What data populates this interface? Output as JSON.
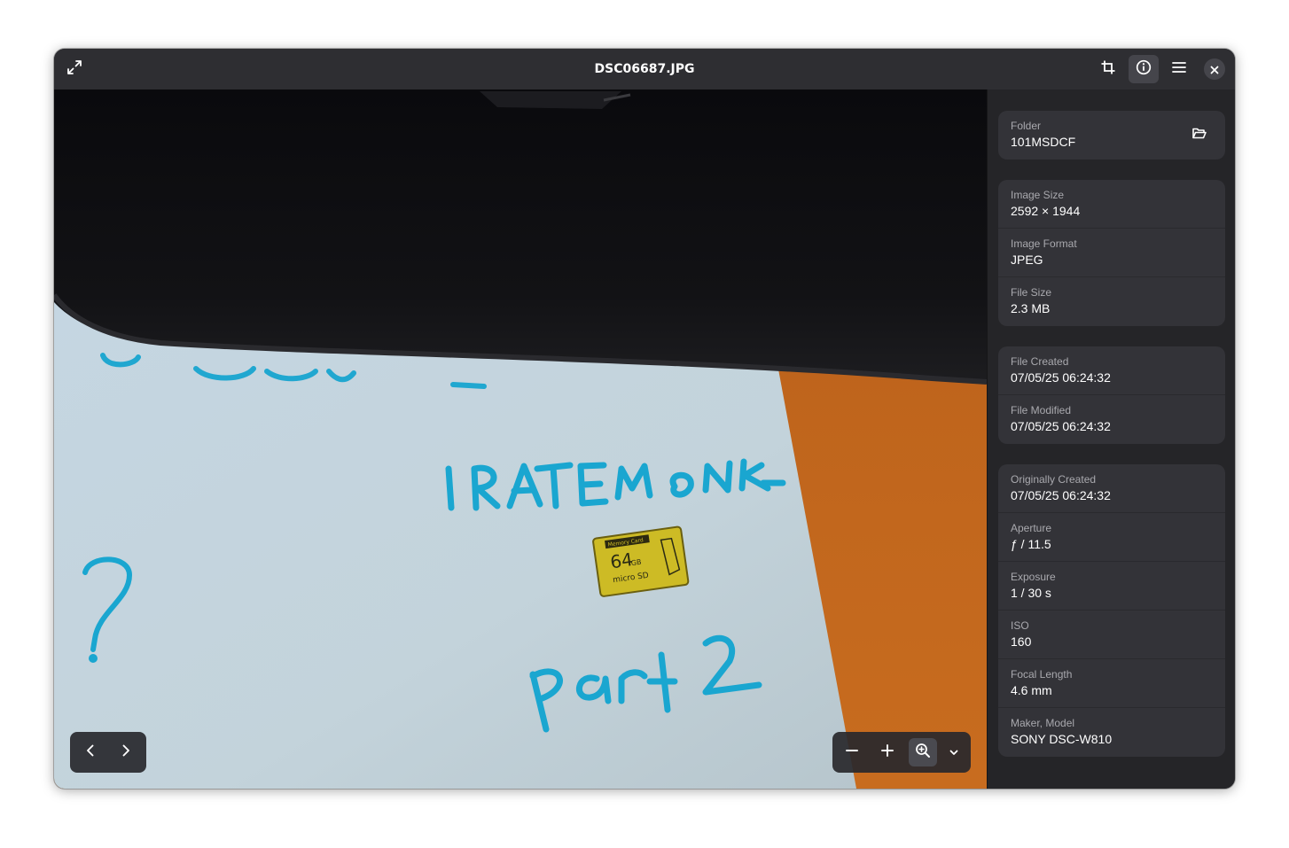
{
  "window": {
    "title": "DSC06687.JPG"
  },
  "headerbar": {
    "fullscreen_icon": "fullscreen-icon",
    "crop_icon": "crop-icon",
    "info_icon": "info-icon",
    "menu_icon": "hamburger-menu-icon",
    "close_icon": "close-icon"
  },
  "photo": {
    "handwritten_text_1": "IRATEMONK",
    "handwritten_text_2": "part 2",
    "handwritten_text_3": "?",
    "card_label": "Memory Card",
    "card_capacity": "64GB",
    "card_type": "micro SD"
  },
  "properties": {
    "folder": {
      "label": "Folder",
      "value": "101MSDCF"
    },
    "image": [
      {
        "label": "Image Size",
        "value": "2592 × 1944"
      },
      {
        "label": "Image Format",
        "value": "JPEG"
      },
      {
        "label": "File Size",
        "value": "2.3 MB"
      }
    ],
    "file_dates": [
      {
        "label": "File Created",
        "value": "07/05/25 06:24:32"
      },
      {
        "label": "File Modified",
        "value": "07/05/25 06:24:32"
      }
    ],
    "exif": [
      {
        "label": "Originally Created",
        "value": "07/05/25 06:24:32"
      },
      {
        "label": "Aperture",
        "value": "ƒ / 11.5"
      },
      {
        "label": "Exposure",
        "value": "1 / 30 s"
      },
      {
        "label": "ISO",
        "value": "160"
      },
      {
        "label": "Focal Length",
        "value": "4.6 mm"
      },
      {
        "label": "Maker, Model",
        "value": "SONY DSC-W810"
      }
    ]
  },
  "colors": {
    "headerbar": "#2e2e32",
    "sidebar": "#252528",
    "card": "#333338",
    "photo_paper": "#c7d6de",
    "photo_desk": "#c0651a",
    "ink": "#18a6cf"
  }
}
